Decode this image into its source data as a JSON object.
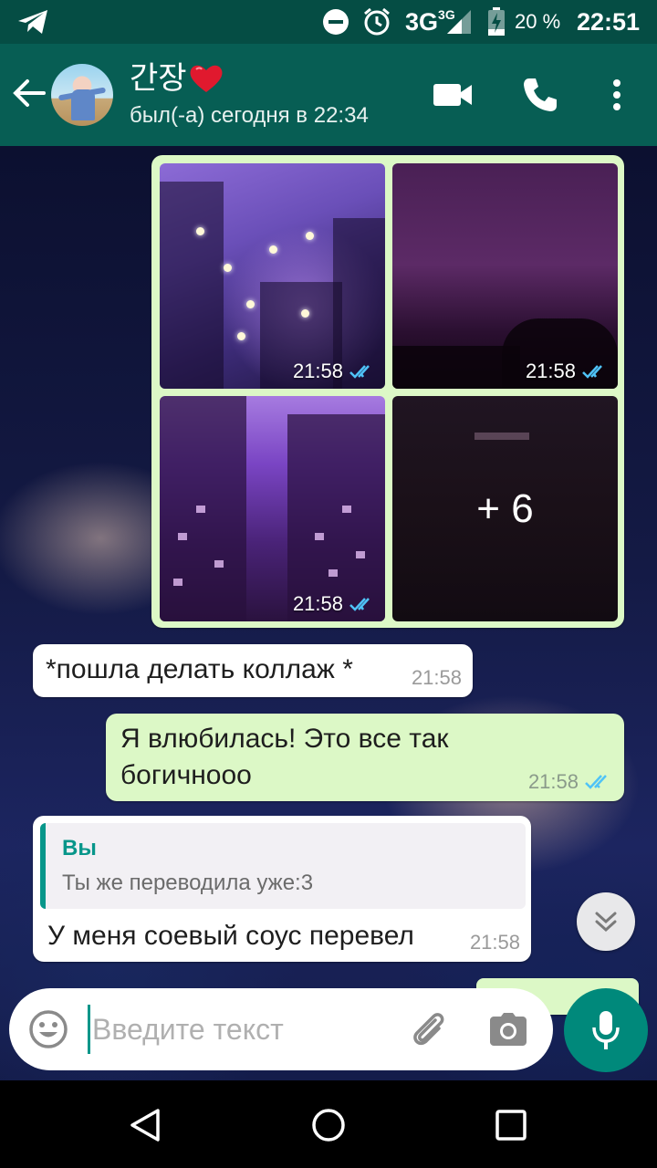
{
  "status_bar": {
    "network": "3G",
    "network_sup": "3G",
    "battery": "20 %",
    "time": "22:51"
  },
  "header": {
    "contact_name": "간장",
    "last_seen": "был(-а) сегодня в 22:34"
  },
  "messages": {
    "photos": {
      "times": [
        "21:58",
        "21:58",
        "21:58"
      ],
      "more_label": "+ 6"
    },
    "m1": {
      "text": "*пошла делать коллаж *",
      "time": "21:58"
    },
    "m2": {
      "line1": "Я влюбилась! Это все так",
      "line2": "богичнооо",
      "time": "21:58"
    },
    "m3": {
      "reply_author": "Вы",
      "reply_text": "Ты же переводила уже:3",
      "text": "У меня соевый соус перевел",
      "time": "21:58"
    }
  },
  "composer": {
    "placeholder": "Введите текст"
  },
  "colors": {
    "header": "#075e54",
    "status_bar": "#054d44",
    "outgoing_bubble": "#dcf8c6",
    "incoming_bubble": "#ffffff",
    "accent": "#00897b",
    "read_ticks": "#4fc3f7"
  }
}
